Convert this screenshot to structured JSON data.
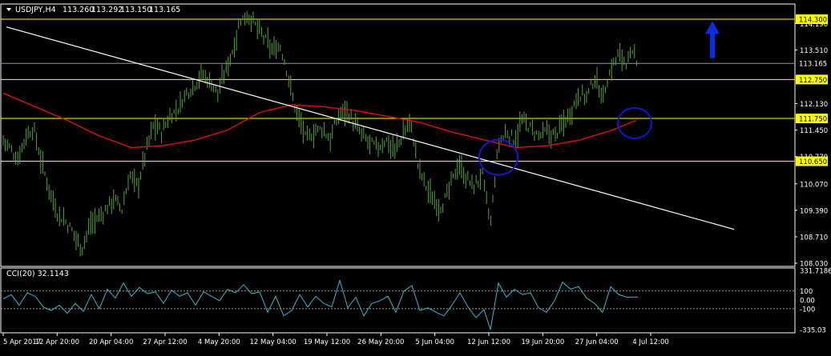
{
  "header": {
    "symbol": "USDJPY,H4",
    "open": "113.260",
    "high": "113.292",
    "low": "113.150",
    "close": "113.165"
  },
  "colors": {
    "background": "#000000",
    "frame": "#ffffff",
    "candles": "#55a630",
    "horizontal_levels": "#ffff00",
    "current_price_line": "#8a9bb3",
    "moving_average": "#e01010",
    "trendline": "#ffffff",
    "circles": "#1515d8",
    "arrow": "#0a2de8",
    "cci_line": "#2fb8c8",
    "cci_level_lines": "#a0a0a0",
    "price_label_bg": "#ffff00",
    "axis_text": "#ffffff"
  },
  "icons": {
    "menu": "triangle-down-icon",
    "up_arrow": "up-arrow-icon"
  },
  "chart_data": [
    {
      "type": "candlestick",
      "title": "USDJPY,H4",
      "ylim": [
        108.03,
        114.5
      ],
      "y_ticks": [
        "114.190",
        "113.510",
        "112.130",
        "111.450",
        "110.770",
        "110.070",
        "109.390",
        "108.710",
        "108.030"
      ],
      "price_labels": [
        {
          "value": 114.3,
          "text": "114.300",
          "kind": "level"
        },
        {
          "value": 113.165,
          "text": "113.165",
          "kind": "current"
        },
        {
          "value": 112.75,
          "text": "112.750",
          "kind": "level"
        },
        {
          "value": 111.75,
          "text": "111.750",
          "kind": "level"
        },
        {
          "value": 110.65,
          "text": "110.650",
          "kind": "level"
        }
      ],
      "x_labels": [
        "5 Apr 2017",
        "12 Apr 20:00",
        "20 Apr 04:00",
        "27 Apr 12:00",
        "4 May 20:00",
        "12 May 04:00",
        "19 May 12:00",
        "26 May 20:00",
        "5 Jun 04:00",
        "12 Jun 12:00",
        "19 Jun 20:00",
        "27 Jun 04:00",
        "4 Jul 12:00"
      ],
      "price_path": [
        [
          0,
          111.2
        ],
        [
          8,
          111.0
        ],
        [
          18,
          110.7
        ],
        [
          28,
          111.3
        ],
        [
          38,
          111.5
        ],
        [
          48,
          110.6
        ],
        [
          58,
          109.9
        ],
        [
          68,
          109.3
        ],
        [
          78,
          109.1
        ],
        [
          88,
          108.8
        ],
        [
          98,
          108.4
        ],
        [
          108,
          109.0
        ],
        [
          118,
          109.2
        ],
        [
          128,
          109.4
        ],
        [
          138,
          109.7
        ],
        [
          148,
          109.4
        ],
        [
          158,
          110.3
        ],
        [
          168,
          110.0
        ],
        [
          178,
          110.9
        ],
        [
          188,
          111.6
        ],
        [
          198,
          111.4
        ],
        [
          208,
          111.8
        ],
        [
          218,
          112.0
        ],
        [
          228,
          112.4
        ],
        [
          238,
          112.6
        ],
        [
          248,
          112.9
        ],
        [
          258,
          112.7
        ],
        [
          268,
          112.4
        ],
        [
          278,
          113.0
        ],
        [
          288,
          113.6
        ],
        [
          296,
          114.3
        ],
        [
          306,
          114.4
        ],
        [
          316,
          114.1
        ],
        [
          326,
          113.8
        ],
        [
          336,
          113.5
        ],
        [
          346,
          113.6
        ],
        [
          354,
          113.0
        ],
        [
          362,
          112.2
        ],
        [
          370,
          111.7
        ],
        [
          378,
          111.2
        ],
        [
          388,
          111.4
        ],
        [
          398,
          111.5
        ],
        [
          408,
          111.2
        ],
        [
          418,
          111.8
        ],
        [
          428,
          112.0
        ],
        [
          438,
          111.6
        ],
        [
          448,
          111.3
        ],
        [
          458,
          111.1
        ],
        [
          468,
          111.0
        ],
        [
          478,
          111.2
        ],
        [
          488,
          110.9
        ],
        [
          498,
          111.3
        ],
        [
          508,
          111.7
        ],
        [
          518,
          110.5
        ],
        [
          528,
          110.0
        ],
        [
          538,
          109.6
        ],
        [
          548,
          109.5
        ],
        [
          558,
          110.0
        ],
        [
          568,
          110.6
        ],
        [
          578,
          110.2
        ],
        [
          588,
          110.0
        ],
        [
          598,
          110.3
        ],
        [
          608,
          109.0
        ],
        [
          618,
          111.1
        ],
        [
          628,
          111.4
        ],
        [
          638,
          111.2
        ],
        [
          648,
          111.7
        ],
        [
          658,
          111.5
        ],
        [
          668,
          111.3
        ],
        [
          678,
          111.4
        ],
        [
          688,
          111.3
        ],
        [
          698,
          111.6
        ],
        [
          708,
          111.9
        ],
        [
          718,
          112.4
        ],
        [
          728,
          112.3
        ],
        [
          738,
          112.8
        ],
        [
          748,
          112.3
        ],
        [
          758,
          113.0
        ],
        [
          768,
          113.4
        ],
        [
          778,
          113.2
        ],
        [
          788,
          113.4
        ],
        [
          792,
          113.2
        ]
      ],
      "moving_average": [
        [
          0,
          112.4
        ],
        [
          40,
          112.05
        ],
        [
          80,
          111.7
        ],
        [
          120,
          111.3
        ],
        [
          160,
          111.0
        ],
        [
          200,
          111.05
        ],
        [
          240,
          111.2
        ],
        [
          280,
          111.45
        ],
        [
          320,
          111.9
        ],
        [
          360,
          112.1
        ],
        [
          400,
          112.05
        ],
        [
          440,
          111.95
        ],
        [
          480,
          111.8
        ],
        [
          520,
          111.65
        ],
        [
          560,
          111.4
        ],
        [
          600,
          111.2
        ],
        [
          640,
          111.0
        ],
        [
          680,
          111.05
        ],
        [
          720,
          111.2
        ],
        [
          760,
          111.45
        ],
        [
          790,
          111.7
        ]
      ],
      "trendline": [
        [
          4,
          114.1
        ],
        [
          912,
          108.9
        ]
      ],
      "circles": [
        {
          "cx": 618,
          "cy": 110.75,
          "rx": 24,
          "ry": 22
        },
        {
          "cx": 788,
          "cy": 111.63,
          "rx": 21,
          "ry": 19
        }
      ],
      "arrow": {
        "x": 885,
        "y_tip": 114.25,
        "y_tail": 113.3
      }
    },
    {
      "type": "line",
      "title": "CCI(20) 32.1143",
      "name": "CCI(20)",
      "last_value": "32.1143",
      "ylim": [
        -335.03,
        331.7186
      ],
      "y_ticks": [
        "331.7186",
        "100",
        "0.00",
        "-100",
        "-335.03"
      ],
      "levels": [
        100,
        -100
      ],
      "values": [
        [
          0,
          10
        ],
        [
          10,
          60
        ],
        [
          20,
          -60
        ],
        [
          30,
          80
        ],
        [
          40,
          40
        ],
        [
          50,
          -80
        ],
        [
          60,
          -120
        ],
        [
          70,
          -60
        ],
        [
          80,
          -150
        ],
        [
          90,
          -40
        ],
        [
          100,
          -130
        ],
        [
          110,
          60
        ],
        [
          120,
          -100
        ],
        [
          130,
          120
        ],
        [
          140,
          20
        ],
        [
          150,
          190
        ],
        [
          160,
          40
        ],
        [
          170,
          140
        ],
        [
          180,
          70
        ],
        [
          190,
          90
        ],
        [
          200,
          -40
        ],
        [
          210,
          110
        ],
        [
          220,
          40
        ],
        [
          230,
          80
        ],
        [
          240,
          -60
        ],
        [
          250,
          90
        ],
        [
          260,
          40
        ],
        [
          270,
          -10
        ],
        [
          280,
          120
        ],
        [
          290,
          80
        ],
        [
          300,
          170
        ],
        [
          310,
          70
        ],
        [
          320,
          90
        ],
        [
          330,
          -140
        ],
        [
          340,
          40
        ],
        [
          350,
          -180
        ],
        [
          360,
          -120
        ],
        [
          370,
          60
        ],
        [
          380,
          -80
        ],
        [
          390,
          40
        ],
        [
          400,
          -40
        ],
        [
          410,
          -80
        ],
        [
          420,
          220
        ],
        [
          430,
          -90
        ],
        [
          440,
          30
        ],
        [
          450,
          -180
        ],
        [
          460,
          -40
        ],
        [
          470,
          -10
        ],
        [
          480,
          40
        ],
        [
          490,
          -140
        ],
        [
          500,
          100
        ],
        [
          510,
          160
        ],
        [
          520,
          -120
        ],
        [
          530,
          -90
        ],
        [
          540,
          -140
        ],
        [
          550,
          -180
        ],
        [
          560,
          -60
        ],
        [
          570,
          80
        ],
        [
          580,
          -80
        ],
        [
          590,
          -200
        ],
        [
          600,
          -110
        ],
        [
          608,
          -335
        ],
        [
          618,
          190
        ],
        [
          628,
          30
        ],
        [
          638,
          120
        ],
        [
          648,
          60
        ],
        [
          658,
          80
        ],
        [
          668,
          -90
        ],
        [
          678,
          -140
        ],
        [
          688,
          -10
        ],
        [
          698,
          200
        ],
        [
          708,
          120
        ],
        [
          718,
          150
        ],
        [
          728,
          20
        ],
        [
          738,
          -40
        ],
        [
          748,
          -140
        ],
        [
          758,
          150
        ],
        [
          768,
          60
        ],
        [
          778,
          30
        ],
        [
          792,
          32
        ]
      ]
    }
  ]
}
